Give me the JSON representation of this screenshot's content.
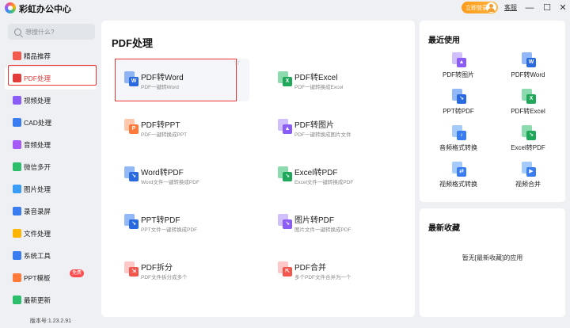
{
  "app": {
    "title": "彩虹办公中心"
  },
  "titlebar": {
    "login_label": "立即登录",
    "feedback_label": "客服",
    "minimize": "—",
    "maximize": "☐",
    "close": "✕"
  },
  "colors": {
    "accent_red": "#e03c3c",
    "pdf_red": "#f2574d",
    "word_blue": "#3a7df0",
    "excel_green": "#2dbe6c",
    "ppt_orange": "#ff7a3a",
    "image_purple": "#8b5cf6",
    "login_orange": "#ff9b1a"
  },
  "sidebar": {
    "search_placeholder": "想搜什么?",
    "items": [
      {
        "label": "精品推荐",
        "icon": "gift-icon",
        "color": "#f25a4d"
      },
      {
        "label": "PDF处理",
        "icon": "pdf-icon",
        "color": "#e33c3c",
        "active": true
      },
      {
        "label": "视频处理",
        "icon": "video-icon",
        "color": "#8b5cf6"
      },
      {
        "label": "CAD处理",
        "icon": "cad-icon",
        "color": "#3a7df0"
      },
      {
        "label": "音频处理",
        "icon": "audio-icon",
        "color": "#a55bf5"
      },
      {
        "label": "微信多开",
        "icon": "wechat-icon",
        "color": "#2dbe6c"
      },
      {
        "label": "图片处理",
        "icon": "image-icon",
        "color": "#3a9df5"
      },
      {
        "label": "录音录屏",
        "icon": "mic-icon",
        "color": "#3a7df0"
      },
      {
        "label": "文件处理",
        "icon": "folder-icon",
        "color": "#ffb400"
      },
      {
        "label": "系统工具",
        "icon": "system-tool-icon",
        "color": "#3a7df0"
      },
      {
        "label": "PPT模板",
        "icon": "ppt-template-icon",
        "color": "#ff7a3a",
        "badge": "免费"
      },
      {
        "label": "最新更新",
        "icon": "update-icon",
        "color": "#2dbe6c"
      }
    ],
    "version": "版本号:1.23.2.91"
  },
  "main": {
    "title": "PDF处理",
    "tools": [
      {
        "name": "PDF转Word",
        "desc": "PDF一键转Word",
        "icon": "pdf-to-word-icon",
        "back": "#3a7df0",
        "front": "#2a6ae0",
        "glyph": "W"
      },
      {
        "name": "PDF转Excel",
        "desc": "PDF一键转换成Excel",
        "icon": "pdf-to-excel-icon",
        "back": "#2dbe6c",
        "front": "#1fa85a",
        "glyph": "X"
      },
      {
        "name": "PDF转PPT",
        "desc": "PDF一键转换成PPT",
        "icon": "pdf-to-ppt-icon",
        "back": "#ff9b6a",
        "front": "#ff7a3a",
        "glyph": "P"
      },
      {
        "name": "PDF转图片",
        "desc": "PDF一键转换成图片文件",
        "icon": "pdf-to-image-icon",
        "back": "#a98bf5",
        "front": "#8b5cf6",
        "glyph": "▲"
      },
      {
        "name": "Word转PDF",
        "desc": "Word文件一键转换成PDF",
        "icon": "word-to-pdf-icon",
        "back": "#3a7df0",
        "front": "#2a6ae0",
        "glyph": "↘"
      },
      {
        "name": "Excel转PDF",
        "desc": "Excel文件一键转换成PDF",
        "icon": "excel-to-pdf-icon",
        "back": "#2dbe6c",
        "front": "#1fa85a",
        "glyph": "↘"
      },
      {
        "name": "PPT转PDF",
        "desc": "PPT文件一键转换成PDF",
        "icon": "ppt-to-pdf-icon",
        "back": "#3a7df0",
        "front": "#2a6ae0",
        "glyph": "↘"
      },
      {
        "name": "图片转PDF",
        "desc": "图片文件一键转换成PDF",
        "icon": "image-to-pdf-icon",
        "back": "#a98bf5",
        "front": "#8b5cf6",
        "glyph": "↘"
      },
      {
        "name": "PDF拆分",
        "desc": "PDF文件拆分成多个",
        "icon": "pdf-split-icon",
        "back": "#ff9b9b",
        "front": "#f2574d",
        "glyph": "⇲"
      },
      {
        "name": "PDF合并",
        "desc": "多个PDF文件合并为一个",
        "icon": "pdf-merge-icon",
        "back": "#ff9b9b",
        "front": "#f2574d",
        "glyph": "⇱"
      }
    ]
  },
  "recent": {
    "title": "最近使用",
    "items": [
      {
        "label": "PDF转图片",
        "icon": "pdf-to-image-icon",
        "back": "#a98bf5",
        "front": "#8b5cf6",
        "glyph": "▲"
      },
      {
        "label": "PDF转Word",
        "icon": "pdf-to-word-icon",
        "back": "#3a7df0",
        "front": "#2a6ae0",
        "glyph": "W"
      },
      {
        "label": "PPT转PDF",
        "icon": "ppt-to-pdf-icon",
        "back": "#3a7df0",
        "front": "#2a6ae0",
        "glyph": "↘"
      },
      {
        "label": "PDF转Excel",
        "icon": "pdf-to-excel-icon",
        "back": "#2dbe6c",
        "front": "#1fa85a",
        "glyph": "X"
      },
      {
        "label": "音频格式转换",
        "icon": "audio-convert-icon",
        "back": "#5aa0f5",
        "front": "#3a7df0",
        "glyph": "♪"
      },
      {
        "label": "Excel转PDF",
        "icon": "excel-to-pdf-icon",
        "back": "#2dbe6c",
        "front": "#1fa85a",
        "glyph": "↘"
      },
      {
        "label": "视频格式转换",
        "icon": "video-convert-icon",
        "back": "#5aa0f5",
        "front": "#3a7df0",
        "glyph": "⇄"
      },
      {
        "label": "视频合并",
        "icon": "video-merge-icon",
        "back": "#5aa0f5",
        "front": "#3a7df0",
        "glyph": "▶"
      }
    ]
  },
  "favorites": {
    "title": "最新收藏",
    "empty_text": "暂无[最新收藏]的应用"
  }
}
